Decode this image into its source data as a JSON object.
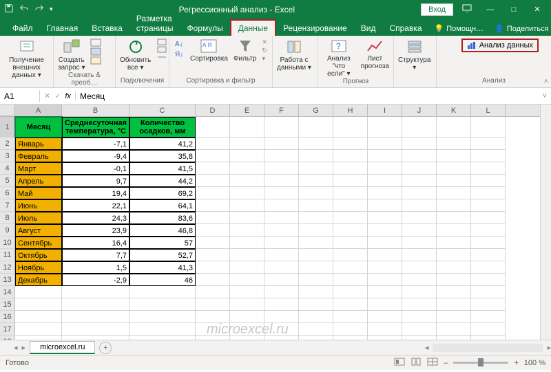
{
  "title": "Регрессионный анализ - Excel",
  "login": "Вход",
  "tabs": [
    "Файл",
    "Главная",
    "Вставка",
    "Разметка страницы",
    "Формулы",
    "Данные",
    "Рецензирование",
    "Вид",
    "Справка"
  ],
  "active_tab": "Данные",
  "helper": "Помощн…",
  "share": "Поделиться",
  "ribbon": {
    "g1": {
      "btn1": "Получение\nвнешних данных ▾",
      "label": ""
    },
    "g2": {
      "btn1": "Создать\nзапрос ▾",
      "label": "Скачать & преоб…"
    },
    "g3": {
      "btn1": "Обновить\nвсе ▾",
      "label": "Подключения"
    },
    "g4": {
      "btn1": "Сортировка",
      "btn2": "Фильтр",
      "label": "Сортировка и фильтр"
    },
    "g5": {
      "btn1": "Работа с\nданными ▾",
      "label": ""
    },
    "g6": {
      "btn1": "Анализ \"что\nесли\" ▾",
      "btn2": "Лист\nпрогноза",
      "label": "Прогноз"
    },
    "g7": {
      "btn1": "Структура\n▾",
      "label": ""
    },
    "g8": {
      "btn1": "Анализ данных",
      "label": "Анализ"
    }
  },
  "namebox": "A1",
  "formula": "Месяц",
  "columns": [
    "A",
    "B",
    "C",
    "D",
    "E",
    "F",
    "G",
    "H",
    "I",
    "J",
    "K",
    "L"
  ],
  "col_widths": {
    "A": 68,
    "B": 98,
    "C": 96
  },
  "headers": {
    "A": "Месяц",
    "B": "Среднесуточная температура, °C",
    "C": "Количество осадков, мм"
  },
  "rows": [
    {
      "n": 2,
      "A": "Январь",
      "B": "-7,1",
      "C": "41,2"
    },
    {
      "n": 3,
      "A": "Февраль",
      "B": "-9,4",
      "C": "35,8"
    },
    {
      "n": 4,
      "A": "Март",
      "B": "-0,1",
      "C": "41,5"
    },
    {
      "n": 5,
      "A": "Апрель",
      "B": "9,7",
      "C": "44,2"
    },
    {
      "n": 6,
      "A": "Май",
      "B": "19,4",
      "C": "69,2"
    },
    {
      "n": 7,
      "A": "Июнь",
      "B": "22,1",
      "C": "64,1"
    },
    {
      "n": 8,
      "A": "Июль",
      "B": "24,3",
      "C": "83,6"
    },
    {
      "n": 9,
      "A": "Август",
      "B": "23,9",
      "C": "46,8"
    },
    {
      "n": 10,
      "A": "Сентябрь",
      "B": "16,4",
      "C": "57"
    },
    {
      "n": 11,
      "A": "Октябрь",
      "B": "7,7",
      "C": "52,7"
    },
    {
      "n": 12,
      "A": "Ноябрь",
      "B": "1,5",
      "C": "41,3"
    },
    {
      "n": 13,
      "A": "Декабрь",
      "B": "-2,9",
      "C": "46"
    }
  ],
  "empty_rows": [
    14,
    15,
    16,
    17,
    18
  ],
  "sheet": "microexcel.ru",
  "status": "Готово",
  "zoom": "100 %",
  "watermark": "microexcel.ru",
  "chart_data": {
    "type": "table",
    "title": "Среднесуточная температура и количество осадков по месяцам",
    "columns": [
      "Месяц",
      "Среднесуточная температура, °C",
      "Количество осадков, мм"
    ],
    "data": [
      [
        "Январь",
        -7.1,
        41.2
      ],
      [
        "Февраль",
        -9.4,
        35.8
      ],
      [
        "Март",
        -0.1,
        41.5
      ],
      [
        "Апрель",
        9.7,
        44.2
      ],
      [
        "Май",
        19.4,
        69.2
      ],
      [
        "Июнь",
        22.1,
        64.1
      ],
      [
        "Июль",
        24.3,
        83.6
      ],
      [
        "Август",
        23.9,
        46.8
      ],
      [
        "Сентябрь",
        16.4,
        57
      ],
      [
        "Октябрь",
        7.7,
        52.7
      ],
      [
        "Ноябрь",
        1.5,
        41.3
      ],
      [
        "Декабрь",
        -2.9,
        46
      ]
    ]
  }
}
